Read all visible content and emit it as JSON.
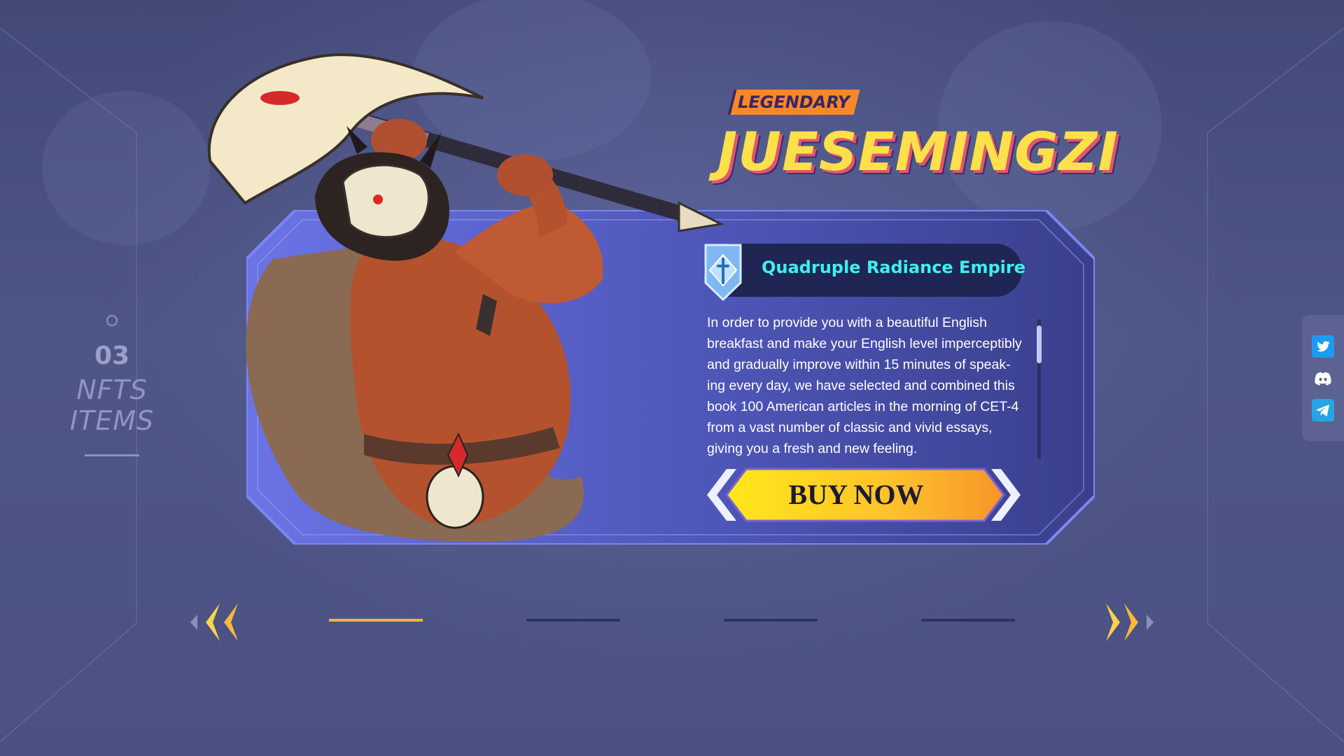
{
  "section": {
    "number": "03",
    "title": "NFTS ITEMS"
  },
  "hero": {
    "rarity": "LEGENDARY",
    "name": "JUESEMINGZI"
  },
  "faction": {
    "name": "Quadruple Radiance Empire",
    "icon": "sword-shield-icon"
  },
  "description": "In order to provide you with a beautiful English breakfast and make your English level imperceptibly and gradually improve within 15 minutes of speak-ing every day, we have selected and combined this book 100 American articles in the morning of CET-4 from a vast number of classic and vivid essays, giving you a fresh and new feeling.",
  "buy_button": {
    "label": "BUY NOW"
  },
  "carousel": {
    "pages": 4,
    "active_index": 0,
    "prev_icon": "double-chevron-left-icon",
    "next_icon": "double-chevron-right-icon"
  },
  "social": [
    {
      "name": "twitter",
      "icon": "twitter-icon",
      "color": "#1d9bf0"
    },
    {
      "name": "discord",
      "icon": "discord-icon",
      "color": "#5865f2"
    },
    {
      "name": "telegram",
      "icon": "telegram-icon",
      "color": "#26a5e4"
    }
  ],
  "colors": {
    "accent": "#f3b14a",
    "name_yellow": "#fde04a",
    "rarity_orange": "#f7882a",
    "faction_cyan": "#3ef0ee",
    "card_blue": "#5a63d8"
  }
}
